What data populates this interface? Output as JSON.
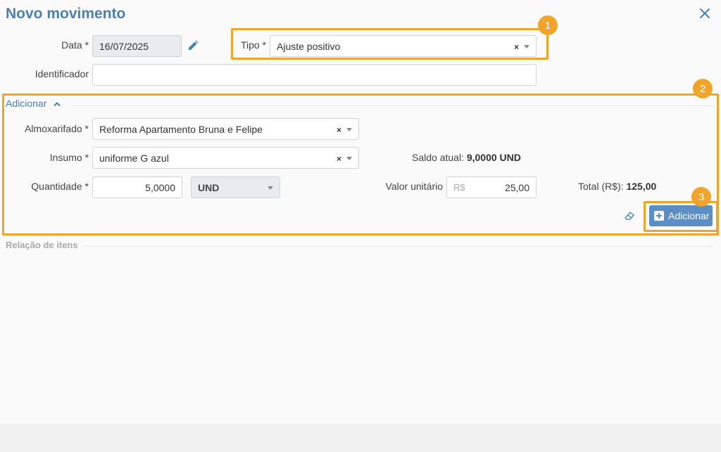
{
  "dialog": {
    "title": "Novo movimento",
    "accent_color": "#4a7fb5",
    "highlight_color": "#f0a52a"
  },
  "form": {
    "data_label": "Data *",
    "data_value": "16/07/2025",
    "tipo_label": "Tipo *",
    "tipo_value": "Ajuste positivo",
    "identificador_label": "Identificador",
    "identificador_value": ""
  },
  "adicionar_section": {
    "title": "Adicionar",
    "almoxarifado_label": "Almoxarifado *",
    "almoxarifado_value": "Reforma Apartamento Bruna e Felipe",
    "insumo_label": "Insumo *",
    "insumo_value": "uniforme G azul",
    "saldo_label": "Saldo atual:",
    "saldo_value": "9,0000 UND",
    "quantidade_label": "Quantidade *",
    "quantidade_value": "5,0000",
    "unidade_value": "UND",
    "valor_unitario_label": "Valor unitário",
    "valor_prefix": "R$",
    "valor_unitario_value": "25,00",
    "total_label": "Total (R$):",
    "total_value": "125,00",
    "add_button_label": "Adicionar"
  },
  "relacao_section": {
    "title": "Relação de itens"
  },
  "clear_symbol": "×",
  "badges": [
    "1",
    "2",
    "3"
  ],
  "icons": {
    "close": "close-icon",
    "edit": "pencil-icon",
    "eraser": "eraser-icon",
    "plus": "plus-square-icon",
    "collapse": "chevron-up-icon"
  }
}
